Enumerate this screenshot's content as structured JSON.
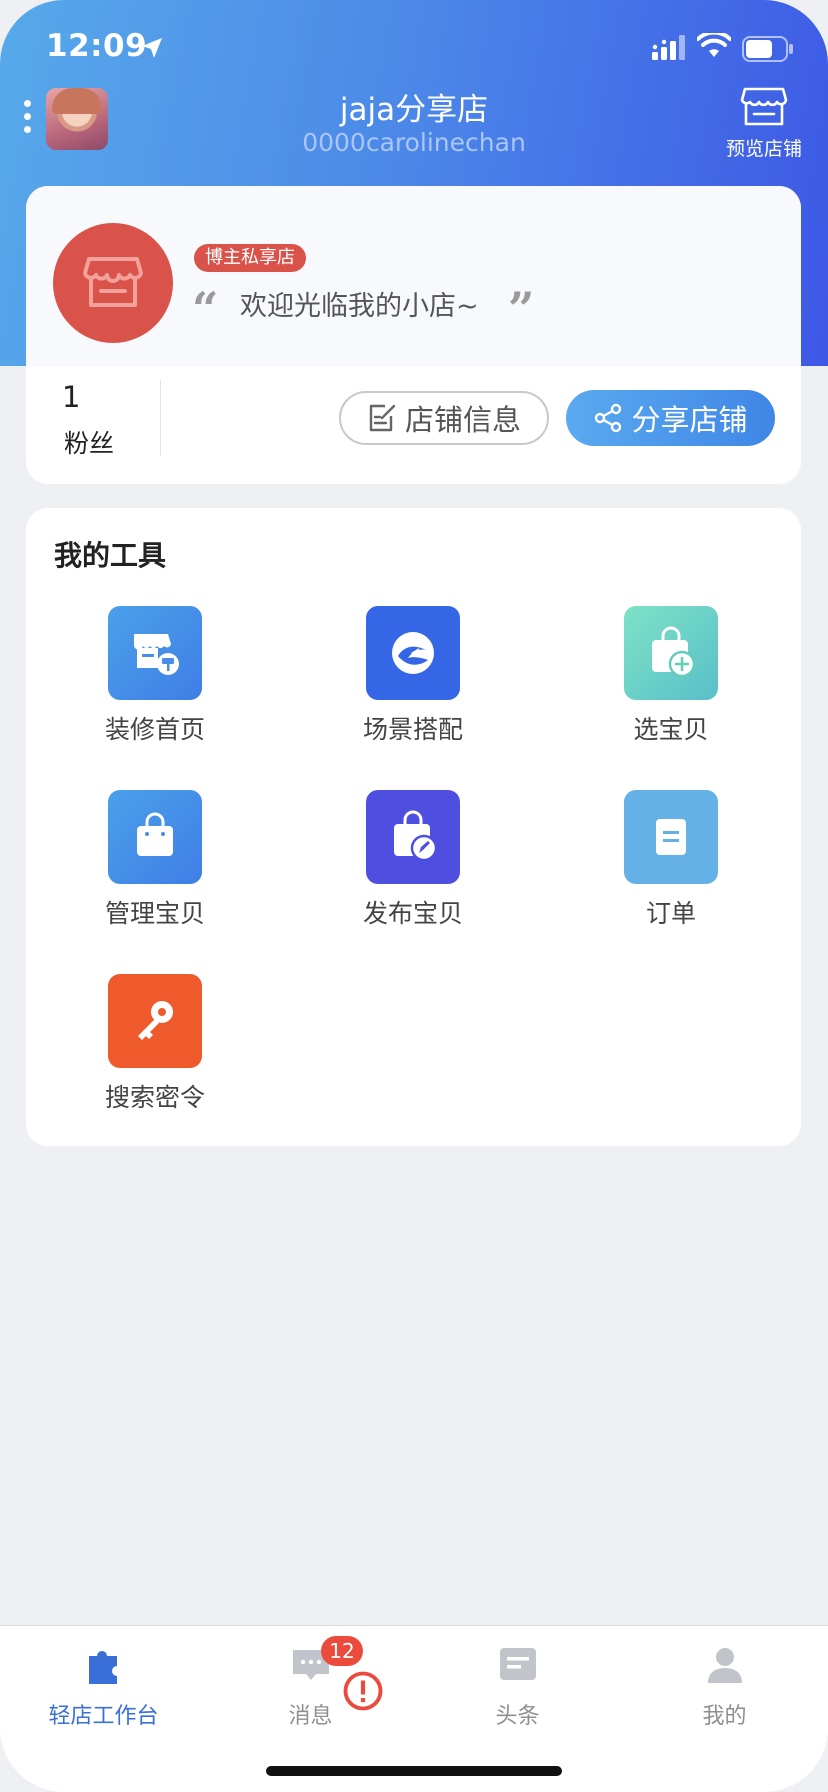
{
  "status_bar": {
    "time": "12:09"
  },
  "header": {
    "shop_name": "jaja分享店",
    "username": "0000carolinechan",
    "preview_label": "预览店铺"
  },
  "shop_card": {
    "badge": "博主私享店",
    "welcome": "欢迎光临我的小店~",
    "fans_count": "1",
    "fans_label": "粉丝",
    "info_button": "店铺信息",
    "share_button": "分享店铺"
  },
  "tools": {
    "title": "我的工具",
    "items": [
      {
        "label": "装修首页",
        "icon": "store-decorate-icon",
        "color": "#4a8de8"
      },
      {
        "label": "场景搭配",
        "icon": "scene-match-icon",
        "color": "#3466e6"
      },
      {
        "label": "选宝贝",
        "icon": "bag-add-icon",
        "color": "#62cdb9"
      },
      {
        "label": "管理宝贝",
        "icon": "shopping-bag-icon",
        "color": "#4a8de8"
      },
      {
        "label": "发布宝贝",
        "icon": "bag-edit-icon",
        "color": "#4e4fe0"
      },
      {
        "label": "订单",
        "icon": "order-document-icon",
        "color": "#63b1e6"
      },
      {
        "label": "搜索密令",
        "icon": "key-icon",
        "color": "#ee5a2c"
      }
    ]
  },
  "tabbar": {
    "items": [
      {
        "label": "轻店工作台",
        "icon": "puzzle-icon",
        "active": true
      },
      {
        "label": "消息",
        "icon": "chat-icon",
        "badge": "12"
      },
      {
        "label": "头条",
        "icon": "news-icon"
      },
      {
        "label": "我的",
        "icon": "person-icon"
      }
    ]
  },
  "colors": {
    "header_gradient_start": "#57a9ea",
    "header_gradient_end": "#3d58e6",
    "accent_red": "#d9534b",
    "active_tab": "#3a6fd8"
  }
}
